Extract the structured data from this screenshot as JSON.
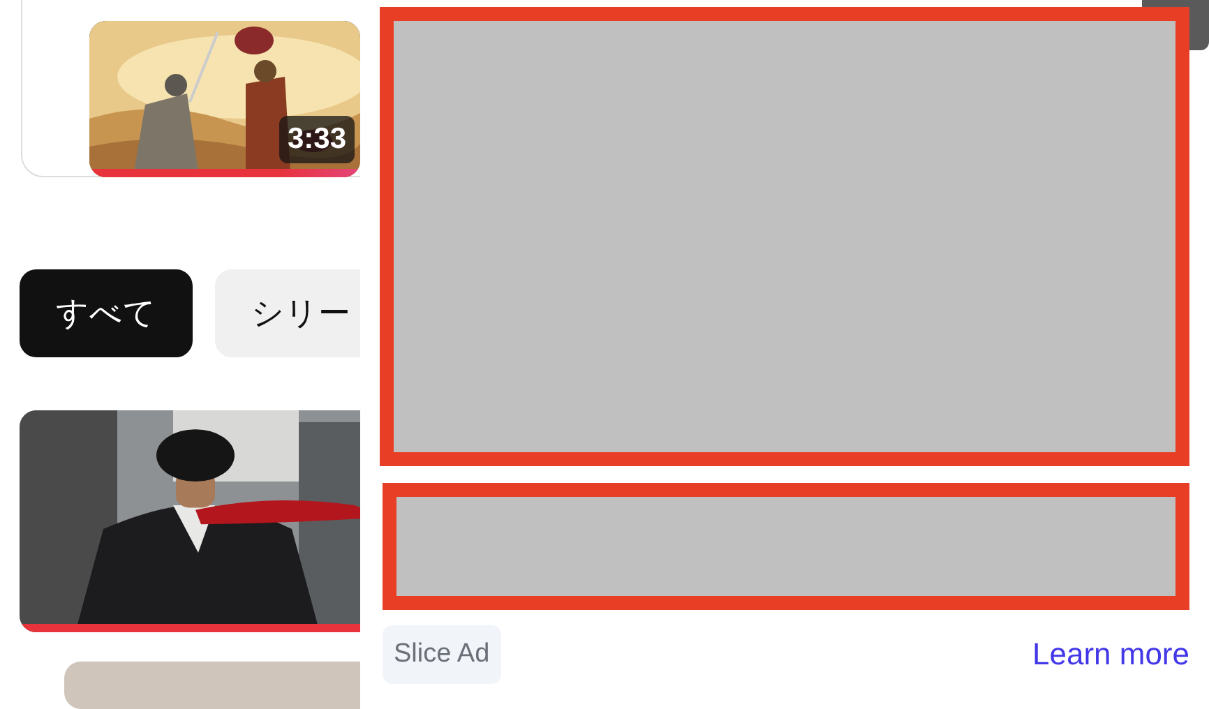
{
  "top_video": {
    "duration": "3:33",
    "progress": {
      "level": 1
    }
  },
  "chips": [
    {
      "label": "すべて",
      "selected": true
    },
    {
      "label": "シリー",
      "selected": false
    }
  ],
  "video": {
    "progress": {
      "level": 1
    }
  },
  "ad": {
    "badge": "Slice Ad",
    "link": "Learn more"
  }
}
